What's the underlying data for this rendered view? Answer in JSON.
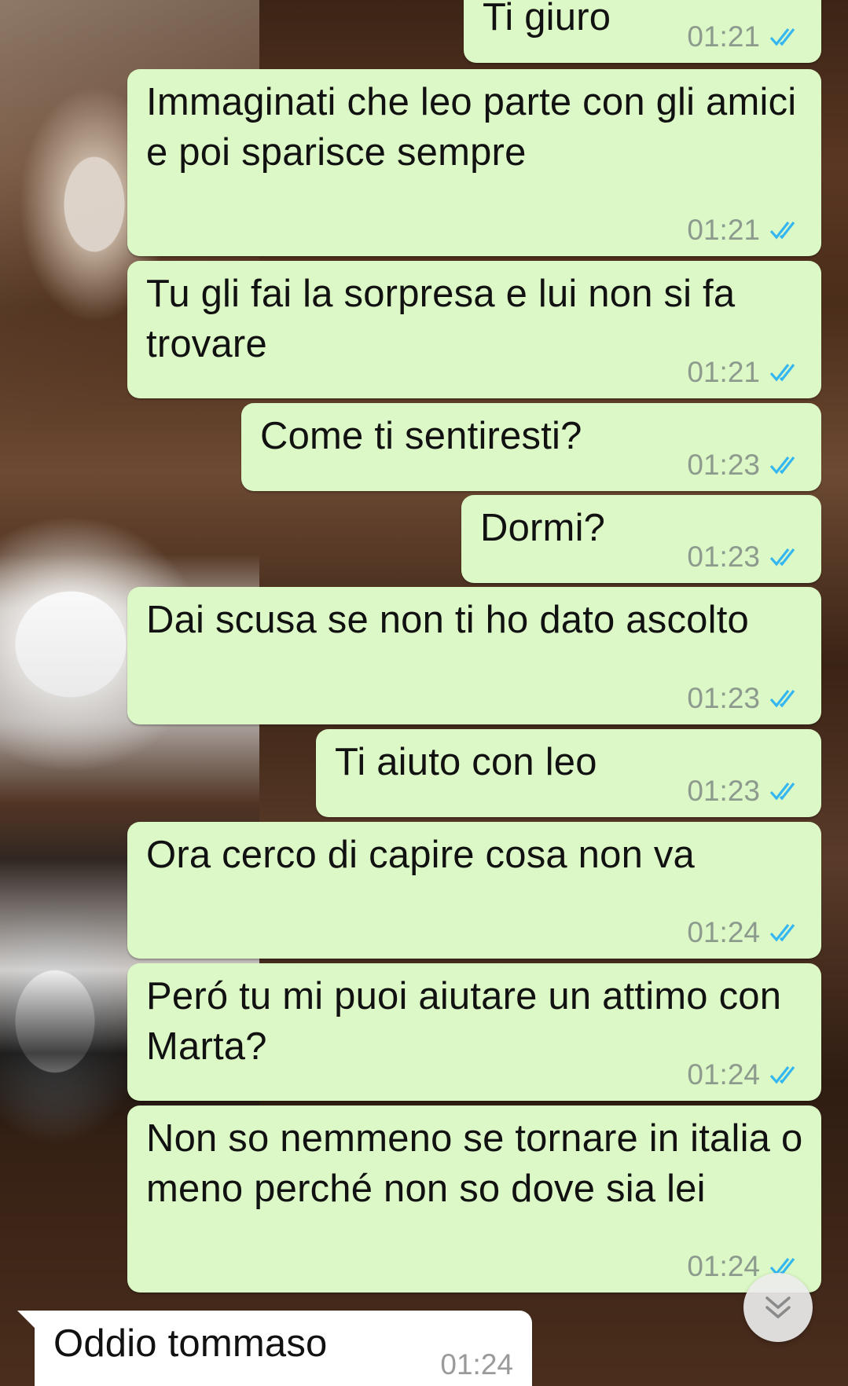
{
  "messages": [
    {
      "text": "Ti giuro",
      "time": "01:21",
      "dir": "out",
      "status": "read"
    },
    {
      "text": "Immaginati che leo parte con gli amici e poi sparisce sempre",
      "time": "01:21",
      "dir": "out",
      "status": "read"
    },
    {
      "text": "Tu gli fai la sorpresa e lui non si fa trovare",
      "time": "01:21",
      "dir": "out",
      "status": "read"
    },
    {
      "text": "Come ti sentiresti?",
      "time": "01:23",
      "dir": "out",
      "status": "read"
    },
    {
      "text": "Dormi?",
      "time": "01:23",
      "dir": "out",
      "status": "read"
    },
    {
      "text": "Dai scusa se non ti ho dato ascolto",
      "time": "01:23",
      "dir": "out",
      "status": "read"
    },
    {
      "text": "Ti aiuto con leo",
      "time": "01:23",
      "dir": "out",
      "status": "read"
    },
    {
      "text": "Ora cerco di capire cosa non va",
      "time": "01:24",
      "dir": "out",
      "status": "read"
    },
    {
      "text": "Peró tu mi puoi aiutare un attimo con Marta?",
      "time": "01:24",
      "dir": "out",
      "status": "read"
    },
    {
      "text": "Non so nemmeno se tornare in italia o meno perché non so dove sia lei",
      "time": "01:24",
      "dir": "out",
      "status": "read"
    },
    {
      "text": "Oddio tommaso",
      "time": "01:24",
      "dir": "in"
    }
  ],
  "icons": {
    "read_ticks": "double-check-icon",
    "scroll_down": "double-chevron-down-icon"
  },
  "colors": {
    "outgoing_bubble": "#dcf8c6",
    "incoming_bubble": "#ffffff",
    "read_tick": "#34b7f1",
    "timestamp": "#8d9a8e"
  }
}
